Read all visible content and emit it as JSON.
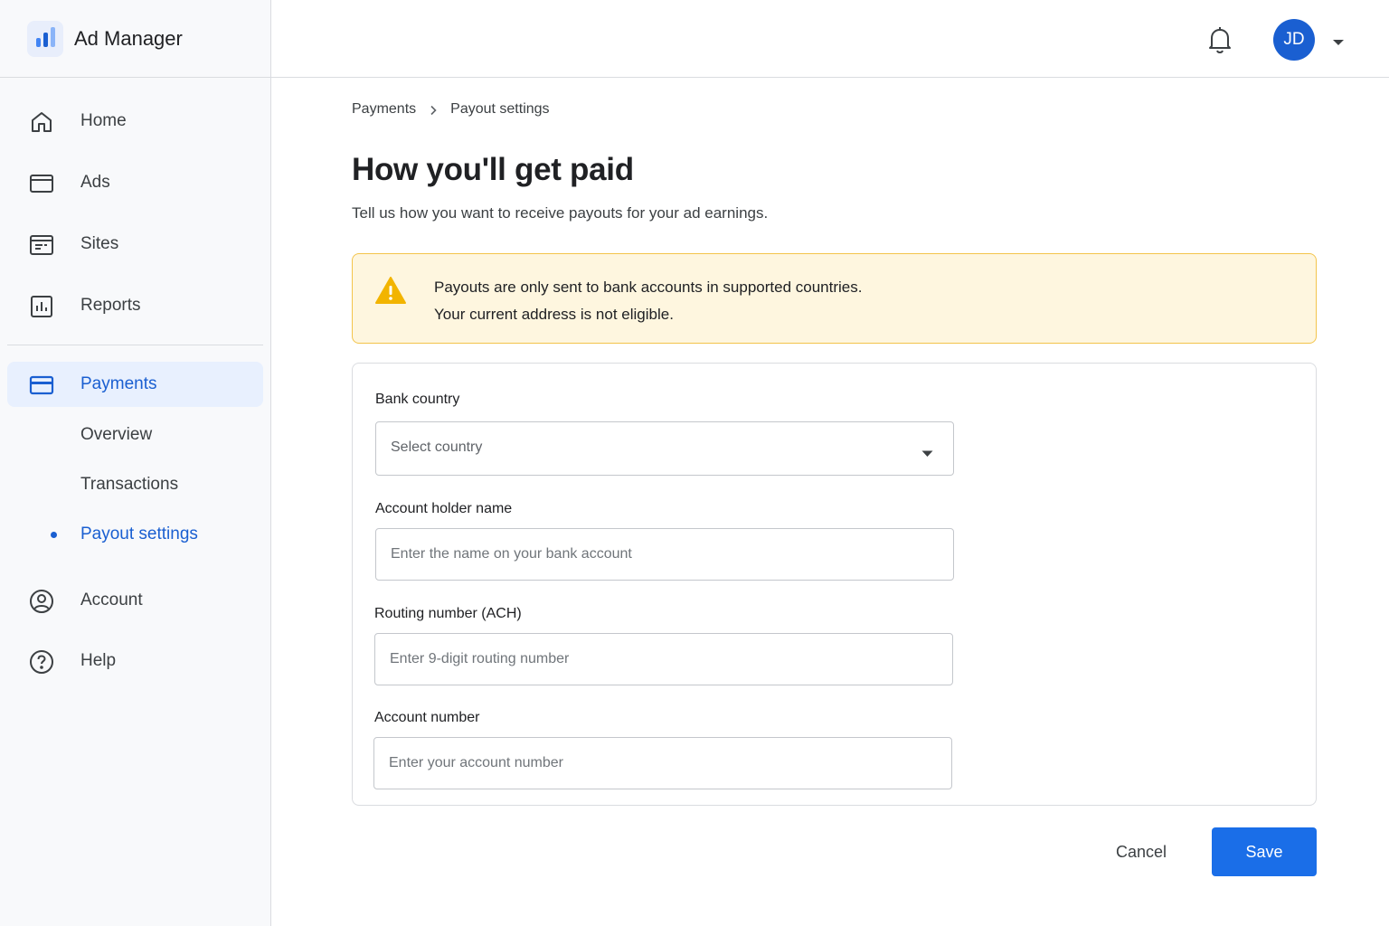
{
  "app": {
    "name": "Ad Manager"
  },
  "sidebar": {
    "items": [
      {
        "label": "Home",
        "icon": "home-icon"
      },
      {
        "label": "Ads",
        "icon": "ads-icon"
      },
      {
        "label": "Sites",
        "icon": "sites-icon"
      },
      {
        "label": "Reports",
        "icon": "reports-icon"
      },
      {
        "label": "Payments",
        "icon": "credit-card-icon",
        "active": true
      },
      {
        "label": "Account",
        "icon": "account-icon"
      },
      {
        "label": "Help",
        "icon": "help-icon"
      }
    ],
    "payments_subitems": [
      {
        "label": "Overview"
      },
      {
        "label": "Transactions"
      },
      {
        "label": "Payout settings",
        "active": true
      }
    ]
  },
  "header": {
    "avatar_initials": "JD"
  },
  "breadcrumb": {
    "items": [
      "Payments",
      "Payout settings"
    ]
  },
  "page": {
    "title": "How you'll get paid",
    "subtitle": "Tell us how you want to receive payouts for your ad earnings."
  },
  "alert": {
    "line1": "Payouts are only sent to bank accounts in supported countries.",
    "line2": "Your current address is not eligible."
  },
  "form": {
    "bank_country": {
      "label": "Bank country",
      "placeholder": "Select country"
    },
    "account_holder": {
      "label": "Account holder name",
      "placeholder": "Enter the name on your bank account",
      "value": ""
    },
    "routing_number": {
      "label": "Routing number (ACH)",
      "placeholder": "Enter 9-digit routing number",
      "value": ""
    },
    "account_number": {
      "label": "Account number",
      "placeholder": "Enter your account number",
      "value": ""
    }
  },
  "actions": {
    "cancel": "Cancel",
    "save": "Save"
  },
  "colors": {
    "accent": "#1a6ee8",
    "active_nav_bg": "#e8f0fe",
    "alert_bg": "#fef6df",
    "alert_border": "#f3c44b",
    "warning_icon": "#f2b400"
  }
}
